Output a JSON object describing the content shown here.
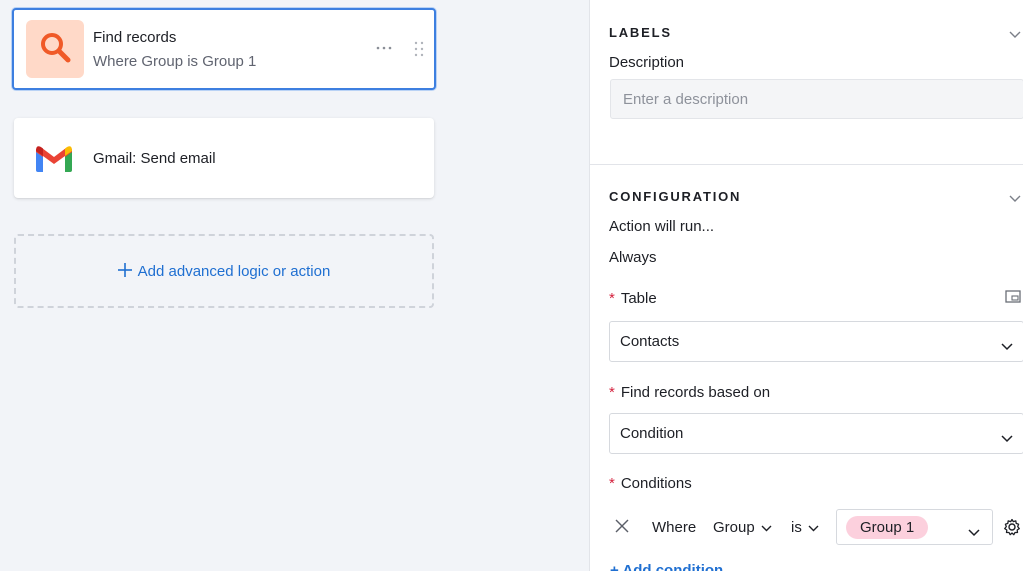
{
  "canvas": {
    "steps": [
      {
        "title": "Find records",
        "subtitle": "Where Group is Group 1",
        "icon": "search-icon"
      },
      {
        "title": "Gmail: Send email",
        "icon": "gmail-icon"
      }
    ],
    "add_action_label": "Add advanced logic or action",
    "add_action_icon": "plus-icon"
  },
  "panel": {
    "labels_section": {
      "heading": "LABELS",
      "description_label": "Description",
      "description_placeholder": "Enter a description",
      "description_value": ""
    },
    "configuration_section": {
      "heading": "CONFIGURATION",
      "run_label": "Action will run...",
      "run_value": "Always",
      "table_label": "Table",
      "table_value": "Contacts",
      "find_based_label": "Find records based on",
      "find_based_value": "Condition",
      "conditions_label": "Conditions",
      "condition": {
        "prefix": "Where",
        "field": "Group",
        "operator": "is",
        "value": "Group 1"
      },
      "add_condition_label": "+ Add condition"
    }
  },
  "colors": {
    "accent": "#1f6fd1",
    "selected_border": "#3d7fe0",
    "search_tile": "#ffd9c8",
    "search_icon": "#f05a28",
    "pill": "#fcd0dd",
    "required": "#d4213d"
  }
}
